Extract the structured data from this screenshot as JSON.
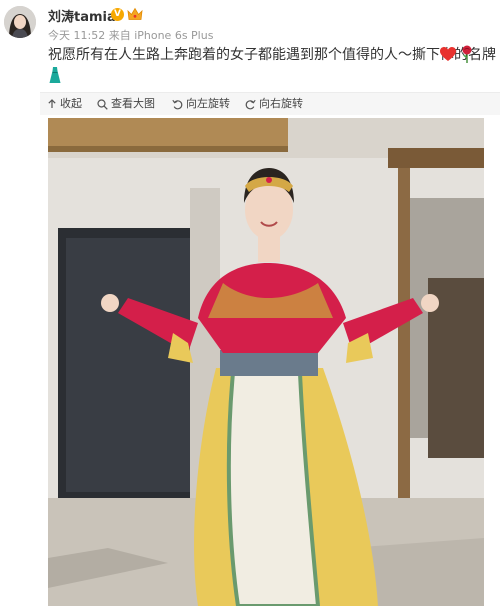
{
  "post": {
    "username": "刘涛tamia",
    "verified_badge": "V",
    "meta": "今天 11:52 来自 iPhone 6s Plus",
    "text": "祝愿所有在人生路上奔跑着的女子都能遇到那个值得的人～撕下你的名牌",
    "emoji": [
      "heart-emoji",
      "rose-emoji",
      "dress-emoji"
    ]
  },
  "toolbar": {
    "collapse": "收起",
    "view_large": "查看大图",
    "rotate_left": "向左旋转",
    "rotate_right": "向右旋转"
  },
  "colors": {
    "vip_gold": "#f7a800",
    "heart_red": "#e8322e",
    "text_gray": "#999999"
  }
}
